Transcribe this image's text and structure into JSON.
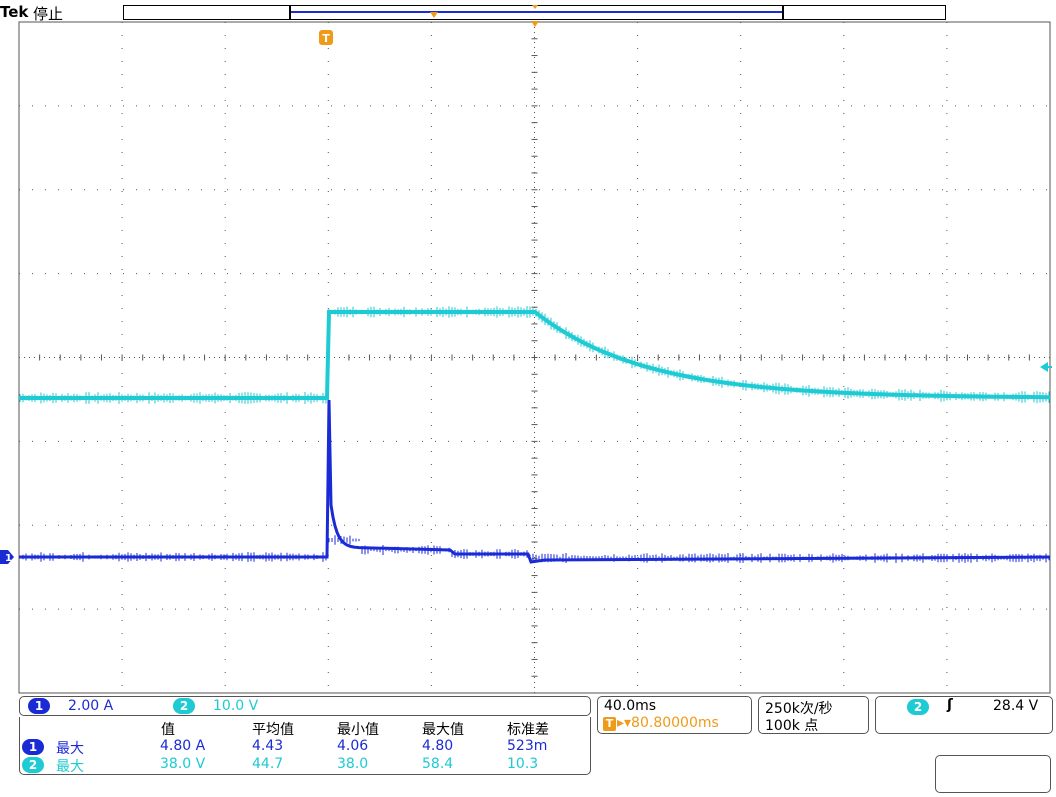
{
  "header": {
    "brand": "Tek",
    "state": "停止"
  },
  "trigger_marker": {
    "label": "T",
    "color": "#f09a1a"
  },
  "channels": [
    {
      "id": "1",
      "scale": "2.00 A",
      "color": "#1a2bd6"
    },
    {
      "id": "2",
      "scale": "10.0 V",
      "color": "#1ecad3"
    }
  ],
  "measurements": {
    "headers": [
      "值",
      "平均值",
      "最小值",
      "最大值",
      "标准差"
    ],
    "rows": [
      {
        "channel": "1",
        "name": "最大",
        "value": "4.80 A",
        "mean": "4.43",
        "min": "4.06",
        "max": "4.80",
        "std": "523m"
      },
      {
        "channel": "2",
        "name": "最大",
        "value": "38.0 V",
        "mean": "44.7",
        "min": "38.0",
        "max": "58.4",
        "std": "10.3"
      }
    ]
  },
  "timebase": {
    "scale": "40.0ms",
    "trigger_delay": "▸▾80.80000ms"
  },
  "acquisition": {
    "rate": "250k次/秒",
    "record_length": "100k 点"
  },
  "trigger": {
    "source": "2",
    "slope_symbol": "ʃ",
    "level": "28.4 V"
  },
  "colors": {
    "grid": "#555555",
    "ch1": "#1a2bd6",
    "ch2": "#1ecad3",
    "trigger": "#f09a1a",
    "background": "#ffffff"
  }
}
